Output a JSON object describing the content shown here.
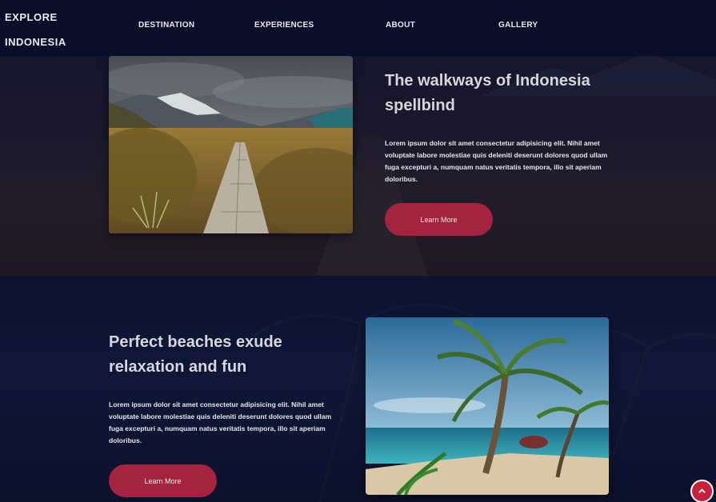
{
  "brand": {
    "line1": "EXPLORE",
    "line2": "INDONESIA"
  },
  "nav": {
    "items": [
      {
        "label": "DESTINATION"
      },
      {
        "label": "EXPERIENCES"
      },
      {
        "label": "ABOUT"
      },
      {
        "label": "GALLERY"
      }
    ]
  },
  "sections": [
    {
      "heading": "The walkways of Indonesia spellbind",
      "body": "Lorem ipsum dolor sit amet consectetur adipisicing elit. Nihil amet voluptate labore molestiae quis deleniti deserunt dolores quod ullam fuga excepturi a, numquam natus veritatis tempora, illo sit aperiam doloribus.",
      "button_label": "Learn More",
      "image": "mountain-boardwalk-photo"
    },
    {
      "heading": "Perfect beaches exude relaxation and fun",
      "body": "Lorem ipsum dolor sit amet consectetur adipisicing elit. Nihil amet voluptate labore molestiae quis deleniti deserunt dolores quod ullam fuga excepturi a, numquam natus veritatis tempora, illo sit aperiam doloribus.",
      "button_label": "Learn More",
      "image": "tropical-beach-palm-photo"
    }
  ],
  "scroll_top": {
    "icon": "chevron-up-icon"
  },
  "colors": {
    "accent": "#c8203a",
    "button": "#a4243f",
    "nav_bg": "#0a0e28"
  }
}
